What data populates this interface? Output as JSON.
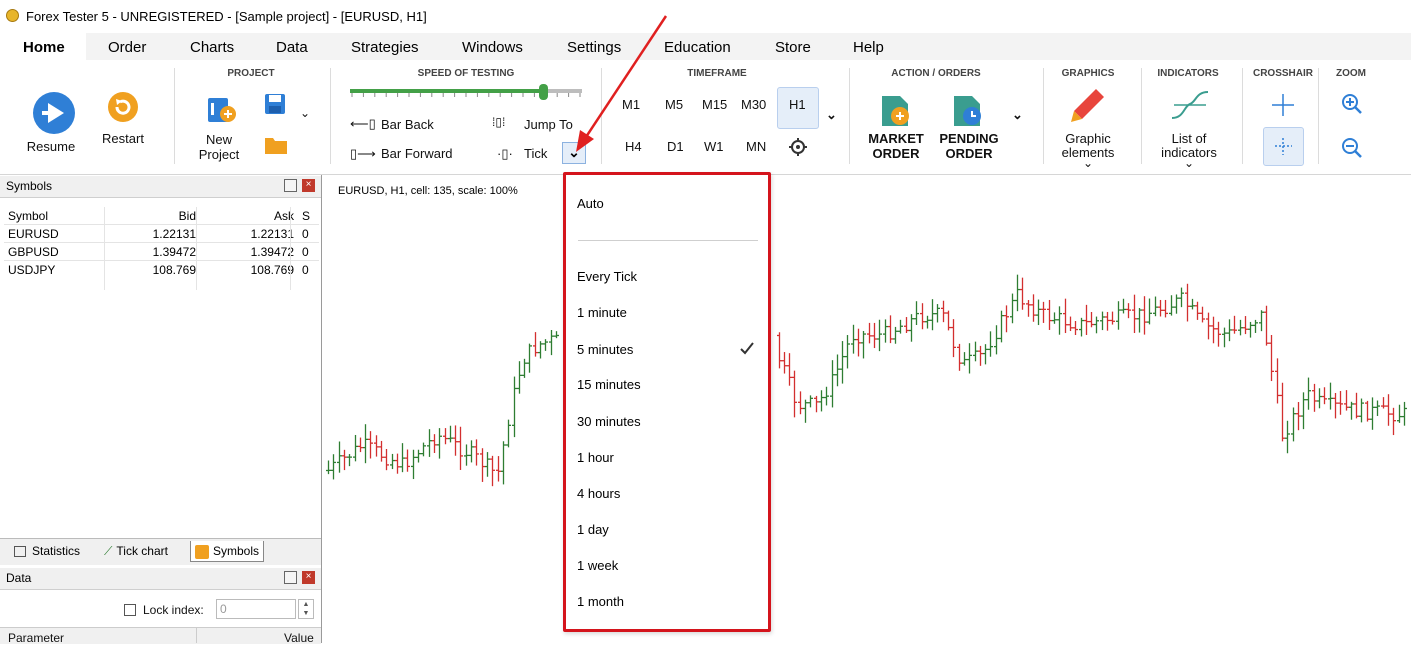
{
  "window": {
    "title": "Forex Tester 5 - UNREGISTERED - [Sample project] - [EURUSD, H1]"
  },
  "menu": {
    "tabs": [
      {
        "label": "Home",
        "active": true
      },
      {
        "label": "Order"
      },
      {
        "label": "Charts"
      },
      {
        "label": "Data"
      },
      {
        "label": "Strategies"
      },
      {
        "label": "Windows"
      },
      {
        "label": "Settings"
      },
      {
        "label": "Education"
      },
      {
        "label": "Store"
      },
      {
        "label": "Help"
      }
    ]
  },
  "ribbon": {
    "resume": "Resume",
    "restart": "Restart",
    "project_group": "PROJECT",
    "new_project_1": "New",
    "new_project_2": "Project",
    "speed_group": "SPEED OF TESTING",
    "speed_level": 0.83,
    "bar_back": "Bar Back",
    "bar_forward": "Bar Forward",
    "jump_to": "Jump To",
    "tick": "Tick",
    "timeframe_group": "TIMEFRAME",
    "timeframes_row1": [
      "M1",
      "M5",
      "M15",
      "M30",
      "H1"
    ],
    "timeframes_row2": [
      "H4",
      "D1",
      "W1",
      "MN"
    ],
    "selected_timeframe": "H1",
    "action_group": "ACTION / ORDERS",
    "market_1": "MARKET",
    "market_2": "ORDER",
    "pending_1": "PENDING",
    "pending_2": "ORDER",
    "graphics_group": "GRAPHICS",
    "graphic_1": "Graphic",
    "graphic_2": "elements",
    "indicators_group": "INDICATORS",
    "indicators_1": "List of",
    "indicators_2": "indicators",
    "crosshair_group": "CROSSHAIR",
    "zoom_group": "ZOOM"
  },
  "symbols_panel": {
    "title": "Symbols",
    "columns": [
      "Symbol",
      "Bid",
      "Ask",
      "S"
    ],
    "rows": [
      [
        "EURUSD",
        "1.22131",
        "1.22131",
        "0"
      ],
      [
        "GBPUSD",
        "1.39472",
        "1.39472",
        "0"
      ],
      [
        "USDJPY",
        "108.769",
        "108.769",
        "0"
      ]
    ]
  },
  "bottom_tabs": {
    "statistics": "Statistics",
    "tick_chart": "Tick chart",
    "symbols": "Symbols"
  },
  "data_panel": {
    "title": "Data",
    "lock_index_label": "Lock index:",
    "lock_index_value": "0",
    "col_parameter": "Parameter",
    "col_value": "Value"
  },
  "chart": {
    "info": "EURUSD, H1, cell: 135, scale: 100%"
  },
  "tick_dropdown": {
    "items": [
      "Auto",
      "Every Tick",
      "1 minute",
      "5 minutes",
      "15 minutes",
      "30 minutes",
      "1 hour",
      "4 hours",
      "1 day",
      "1 week",
      "1 month"
    ],
    "selected": "5 minutes"
  },
  "colors": {
    "accent_blue": "#2f7fd6",
    "bull": "#2e7d32",
    "bear": "#d32f2f",
    "highlight": "#d4141c",
    "order_green": "#3a9d8f",
    "orange": "#e8a033"
  },
  "icons": [
    "resume-icon",
    "restart-icon",
    "new-project-icon",
    "save-icon",
    "open-folder-icon",
    "bar-back-icon",
    "bar-forward-icon",
    "jump-to-icon",
    "tick-icon",
    "gear-icon",
    "market-order-icon",
    "pending-order-icon",
    "pencil-icon",
    "indicator-curve-icon",
    "crosshair-icon",
    "zoom-in-icon",
    "zoom-out-icon",
    "checkmark-icon",
    "red-arrow-annotation"
  ]
}
